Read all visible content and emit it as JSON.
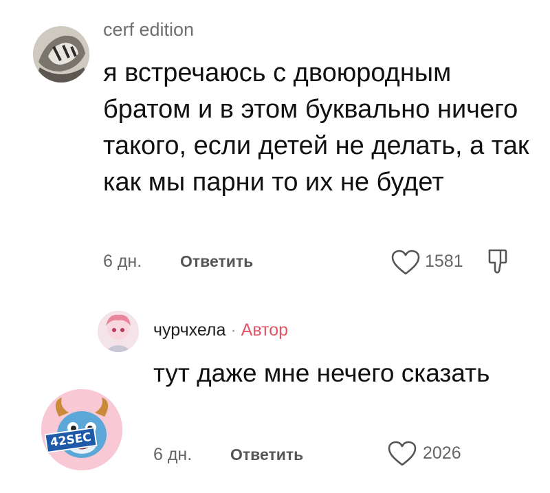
{
  "comment1": {
    "username": "cerf edition",
    "text": "я встречаюсь с двоюродным братом и в этом буквально ничего такого, если детей не делать, а так как мы парни то их не будет",
    "time": "6 дн.",
    "reply_label": "Ответить",
    "likes": "1581"
  },
  "comment2": {
    "username": "чурчхела",
    "separator": "·",
    "author_badge": "Автор",
    "text": "тут даже мне нечего сказать",
    "time": "6 дн.",
    "reply_label": "Ответить",
    "likes": "2026"
  },
  "watermark": {
    "badge": "42SEC"
  },
  "colors": {
    "author_accent": "#e05565",
    "text_primary": "#111111",
    "text_secondary": "#666666"
  },
  "icons": [
    "heart-outline-icon",
    "dislike-icon"
  ]
}
